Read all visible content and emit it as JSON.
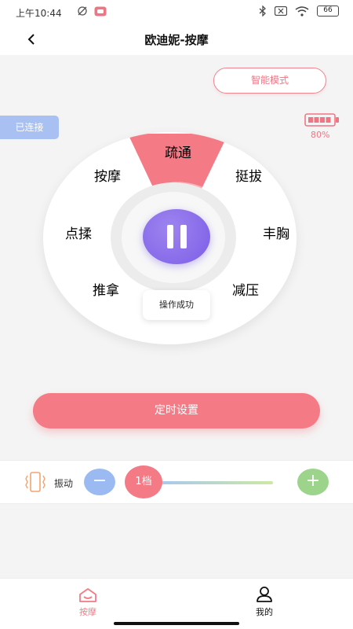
{
  "status": {
    "time": "上午10:44",
    "battery": "66"
  },
  "nav": {
    "title": "欧迪妮-按摩"
  },
  "smart_mode_label": "智能模式",
  "connection_status": "已连接",
  "device_battery": {
    "percent": "80%",
    "level": 0.8
  },
  "dial": {
    "modes": [
      {
        "label": "疏通",
        "active": true
      },
      {
        "label": "挺拔",
        "active": false
      },
      {
        "label": "丰胸",
        "active": false
      },
      {
        "label": "减压",
        "active": false
      },
      {
        "label": "推拿",
        "active": false
      },
      {
        "label": "点揉",
        "active": false
      },
      {
        "label": "按摩",
        "active": false
      }
    ],
    "playing_icon": "pause-icon",
    "toast": "操作成功"
  },
  "timer_label": "定时设置",
  "vibration": {
    "label": "振动",
    "level_label": "1档",
    "minus": "−",
    "plus": "+"
  },
  "tabs": [
    {
      "label": "按摩",
      "icon": "home-icon",
      "active": true
    },
    {
      "label": "我的",
      "icon": "user-icon",
      "active": false
    }
  ],
  "colors": {
    "accent": "#f47a86",
    "purple": "#7b5ee6",
    "blue": "#9cbaf2",
    "green": "#9bd48a"
  }
}
